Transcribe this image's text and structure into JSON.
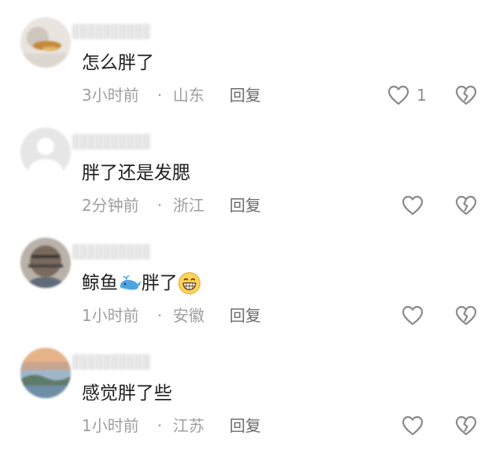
{
  "colors": {
    "text_primary": "#1f1f1f",
    "text_meta": "#9f9f9f",
    "reply": "#6b6b6b",
    "icon": "#8a8a8a"
  },
  "comments": [
    {
      "text": "怎么胖了",
      "time": "3小时前",
      "separator": "·",
      "location": "山东",
      "reply_label": "回复",
      "like_count": "1",
      "like_icon": "heart-outline-icon",
      "dislike_icon": "broken-heart-icon"
    },
    {
      "text": "胖了还是发腮",
      "time": "2分钟前",
      "separator": "·",
      "location": "浙江",
      "reply_label": "回复",
      "like_count": "",
      "like_icon": "heart-outline-icon",
      "dislike_icon": "broken-heart-icon"
    },
    {
      "text_before": "鲸鱼",
      "text_after": "胖了",
      "emoji_1": "whale-emoji",
      "emoji_2": "grinning-face-emoji",
      "time": "1小时前",
      "separator": "·",
      "location": "安徽",
      "reply_label": "回复",
      "like_count": "",
      "like_icon": "heart-outline-icon",
      "dislike_icon": "broken-heart-icon"
    },
    {
      "text": "感觉胖了些",
      "time": "1小时前",
      "separator": "·",
      "location": "江苏",
      "reply_label": "回复",
      "like_count": "",
      "like_icon": "heart-outline-icon",
      "dislike_icon": "broken-heart-icon"
    }
  ]
}
